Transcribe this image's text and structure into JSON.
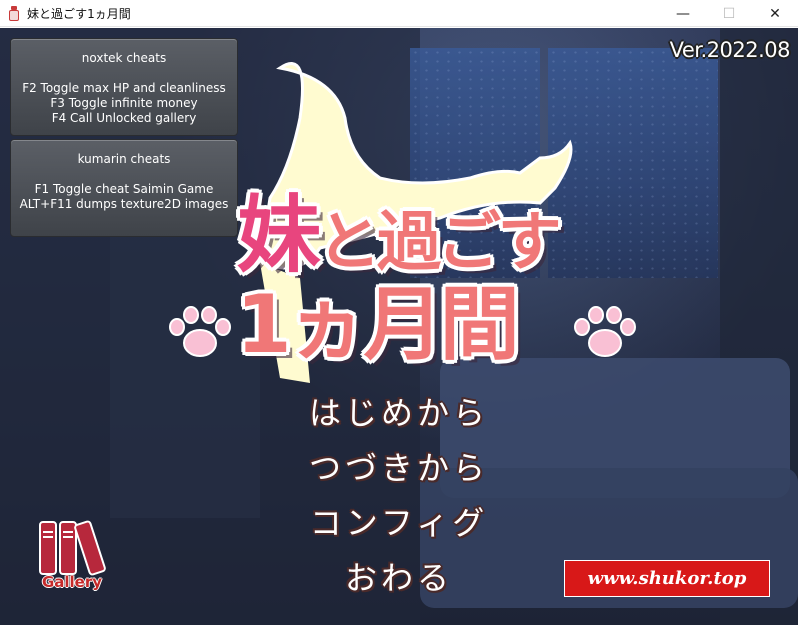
{
  "window": {
    "title": "妹と過ごす1ヵ月間",
    "controls": {
      "minimize": "—",
      "maximize": "☐",
      "close": "✕"
    }
  },
  "cheats": [
    {
      "heading": "noxtek cheats",
      "lines": [
        "F2 Toggle max HP and cleanliness",
        "F3 Toggle infinite money",
        "F4 Call Unlocked gallery"
      ]
    },
    {
      "heading": "kumarin cheats",
      "lines": [
        "F1 Toggle cheat Saimin Game",
        "ALT+F11 dumps texture2D images"
      ]
    }
  ],
  "version": "Ver.2022.08",
  "logo": {
    "line1_first": "妹",
    "line1_rest": "と過ごす",
    "line2": "1ヵ月間"
  },
  "menu": {
    "new_game": "はじめから",
    "continue": "つづきから",
    "config": "コンフィグ",
    "quit": "おわる"
  },
  "gallery_label": "Gallery",
  "site_banner": "www.shukor.top",
  "colors": {
    "logo_pink": "#f07777",
    "logo_magenta": "#e8457e",
    "banner_red": "#d81818",
    "cat_cream": "#fffbd0"
  }
}
